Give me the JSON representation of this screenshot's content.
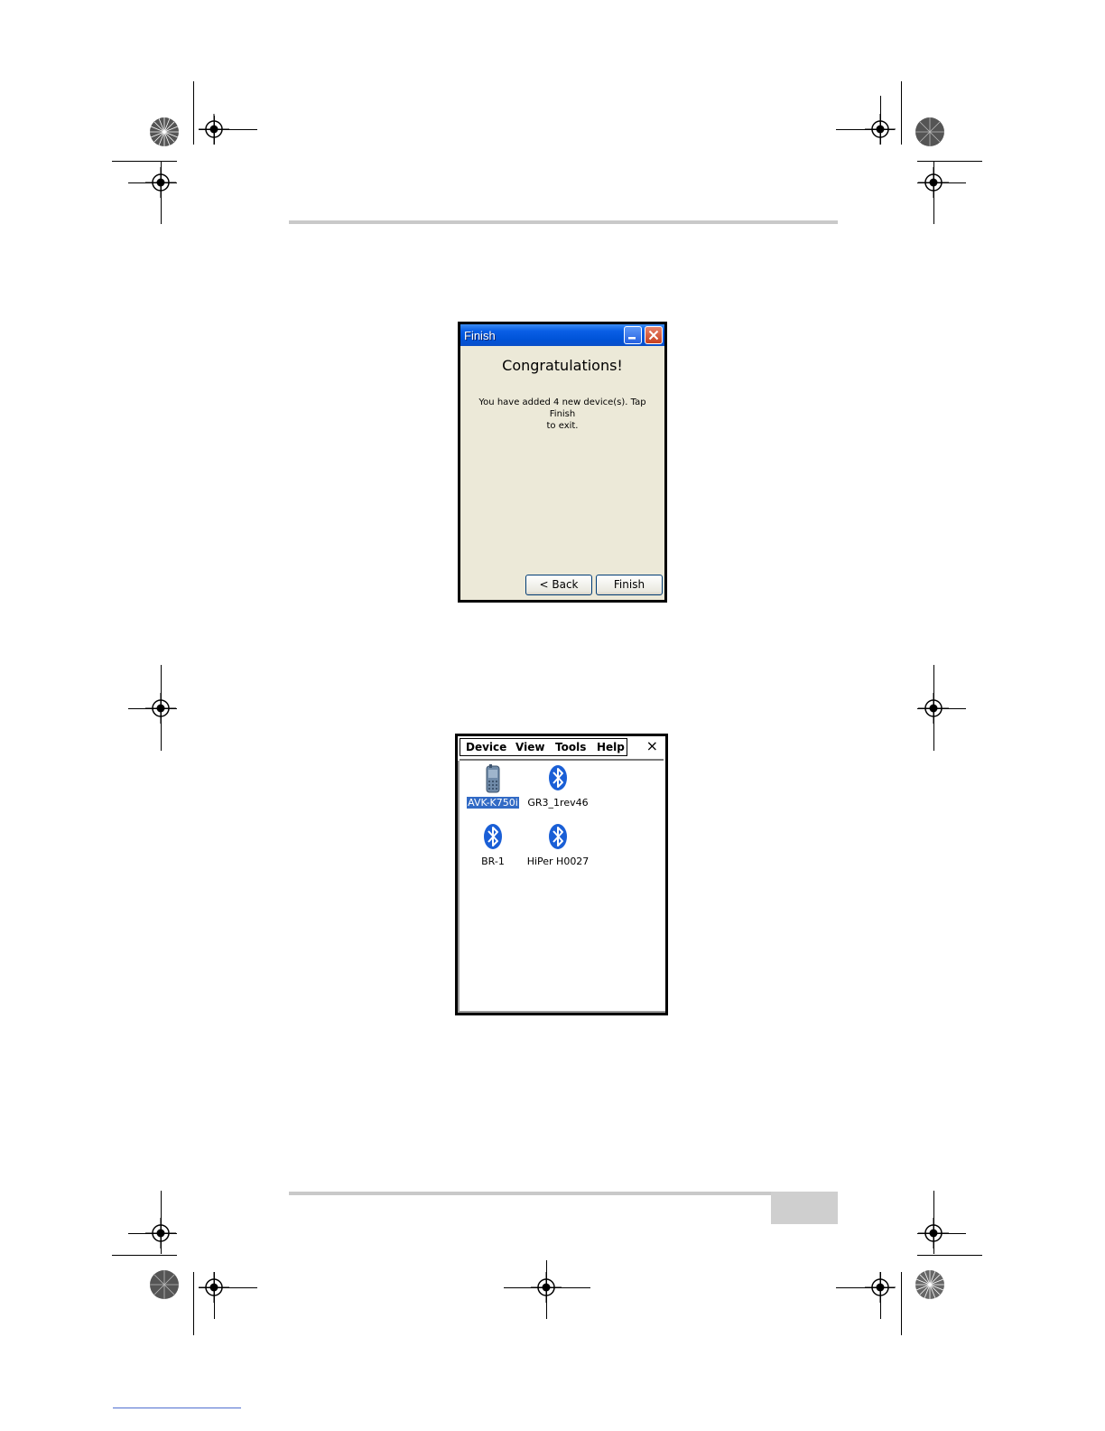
{
  "finish_dialog": {
    "title": "Finish",
    "heading": "Congratulations!",
    "message_line1": "You have added 4 new device(s). Tap Finish",
    "message_line2": "to exit.",
    "back_label": "< Back",
    "finish_label": "Finish"
  },
  "bluetooth_manager": {
    "menu": [
      "Device",
      "View",
      "Tools",
      "Help"
    ],
    "close_label": "×",
    "devices": [
      {
        "label": "AVK-K750i",
        "icon": "phone-icon",
        "selected": true
      },
      {
        "label": "GR3_1rev46",
        "icon": "bluetooth-icon",
        "selected": false
      },
      {
        "label": "BR-1",
        "icon": "bluetooth-icon",
        "selected": false
      },
      {
        "label": "HiPer H0027",
        "icon": "bluetooth-icon",
        "selected": false
      }
    ]
  },
  "colors": {
    "titlebar_blue": "#0053d8",
    "dialog_bg": "#ece9d8",
    "selection_blue": "#316ac5",
    "bluetooth_blue": "#1a5fd6"
  }
}
